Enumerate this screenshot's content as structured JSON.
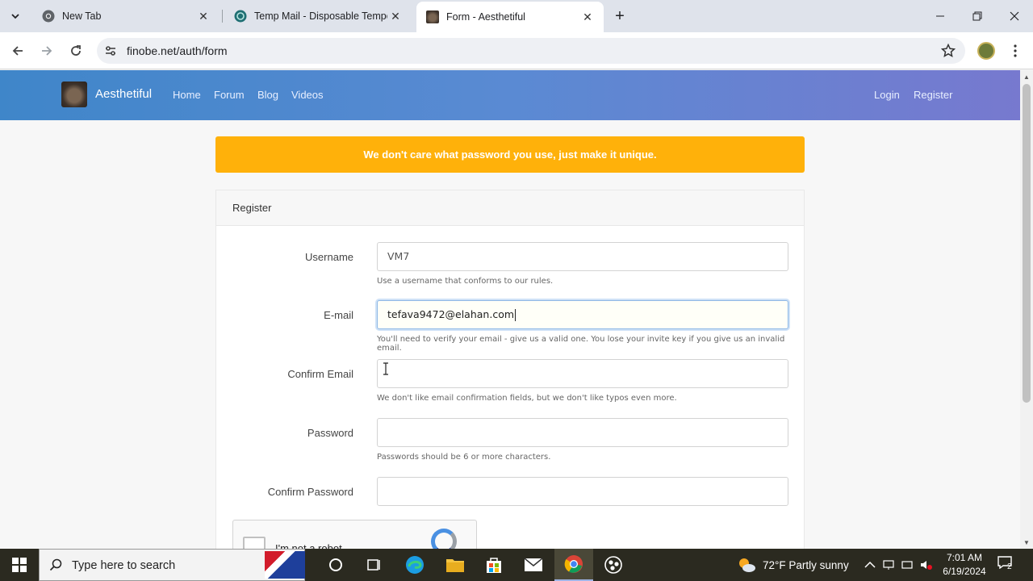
{
  "browser": {
    "tabs": [
      {
        "title": "New Tab",
        "close": "✕"
      },
      {
        "title": "Temp Mail - Disposable Tempo",
        "close": "✕"
      },
      {
        "title": "Form - Aesthetiful",
        "close": "✕"
      }
    ],
    "new_tab": "+",
    "url": "finobe.net/auth/form"
  },
  "site": {
    "brand": "Aesthetiful",
    "nav": [
      "Home",
      "Forum",
      "Blog",
      "Videos"
    ],
    "nav_right": [
      "Login",
      "Register"
    ],
    "alert": "We don't care what password you use, just make it unique."
  },
  "form": {
    "title": "Register",
    "fields": [
      {
        "label": "Username",
        "value": "VM7",
        "help": "Use a username that conforms to our rules."
      },
      {
        "label": "E-mail",
        "value": "tefava9472@elahan.com",
        "help": "You'll need to verify your email - give us a valid one. You lose your invite key if you give us an invalid email."
      },
      {
        "label": "Confirm Email",
        "value": "",
        "help": "We don't like email confirmation fields, but we don't like typos even more."
      },
      {
        "label": "Password",
        "value": "",
        "help": "Passwords should be 6 or more characters."
      },
      {
        "label": "Confirm Password",
        "value": "",
        "help": ""
      }
    ],
    "captcha_label": "I'm not a robot"
  },
  "taskbar": {
    "search_placeholder": "Type here to search",
    "weather": "72°F  Partly sunny",
    "time": "7:01 AM",
    "date": "6/19/2024",
    "notifications": "2"
  },
  "colors": {
    "alert": "#ffb10a",
    "nav_start": "#3f86c9",
    "nav_end": "#7779cf"
  }
}
